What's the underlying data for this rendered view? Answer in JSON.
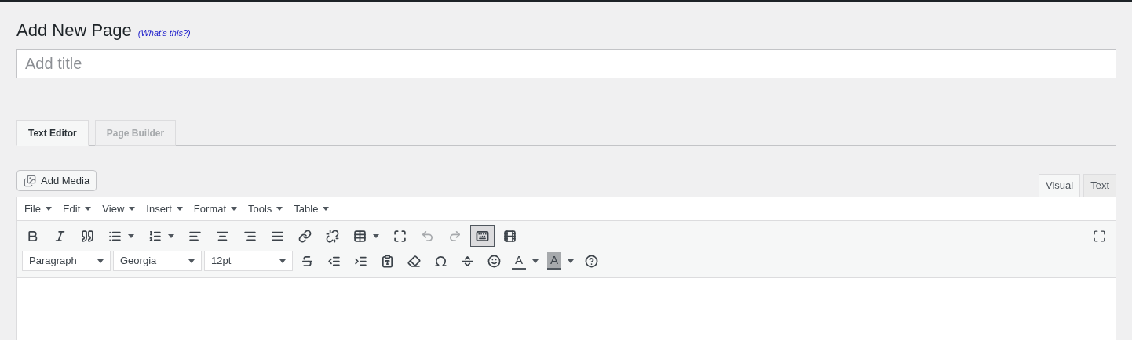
{
  "heading": {
    "title": "Add New Page",
    "help_link": "(What's this?)"
  },
  "title_field": {
    "placeholder": "Add title"
  },
  "builder_tabs": [
    {
      "label": "Text Editor",
      "selected": true
    },
    {
      "label": "Page Builder",
      "selected": false
    }
  ],
  "add_media": {
    "label": "Add Media"
  },
  "mode_tabs": [
    {
      "label": "Visual",
      "selected": true
    },
    {
      "label": "Text",
      "selected": false
    }
  ],
  "menu_bar": [
    "File",
    "Edit",
    "View",
    "Insert",
    "Format",
    "Tools",
    "Table"
  ],
  "toolbar_1": [
    {
      "kind": "bold",
      "disabled": false,
      "pressed": false
    },
    {
      "kind": "italic",
      "disabled": false,
      "pressed": false
    },
    {
      "kind": "quote",
      "disabled": false,
      "pressed": false
    },
    {
      "kind": "bullets",
      "disabled": false,
      "pressed": false
    },
    {
      "kind": "numbers",
      "disabled": false,
      "pressed": false
    },
    {
      "kind": "align-left",
      "disabled": false,
      "pressed": false
    },
    {
      "kind": "align-center",
      "disabled": false,
      "pressed": false
    },
    {
      "kind": "align-right",
      "disabled": false,
      "pressed": false
    },
    {
      "kind": "justify",
      "disabled": false,
      "pressed": false
    },
    {
      "kind": "link",
      "disabled": false,
      "pressed": false
    },
    {
      "kind": "unlink",
      "disabled": false,
      "pressed": false
    },
    {
      "kind": "table",
      "disabled": false,
      "pressed": false
    },
    {
      "kind": "fullscreen",
      "disabled": false,
      "pressed": false
    },
    {
      "kind": "undo",
      "disabled": true,
      "pressed": false
    },
    {
      "kind": "redo",
      "disabled": true,
      "pressed": false
    },
    {
      "kind": "toolbar-toggle",
      "disabled": false,
      "pressed": true
    },
    {
      "kind": "media",
      "disabled": false,
      "pressed": false
    }
  ],
  "selects": [
    {
      "value": "Paragraph"
    },
    {
      "value": "Georgia"
    },
    {
      "value": "12pt"
    }
  ],
  "toolbar_2": [
    {
      "kind": "strikethrough"
    },
    {
      "kind": "outdent"
    },
    {
      "kind": "indent"
    },
    {
      "kind": "paste-text"
    },
    {
      "kind": "eraser"
    },
    {
      "kind": "omega"
    },
    {
      "kind": "more"
    },
    {
      "kind": "emoji"
    },
    {
      "kind": "text-color",
      "label": "A"
    },
    {
      "kind": "bg-color",
      "label": "A"
    },
    {
      "kind": "help"
    }
  ]
}
